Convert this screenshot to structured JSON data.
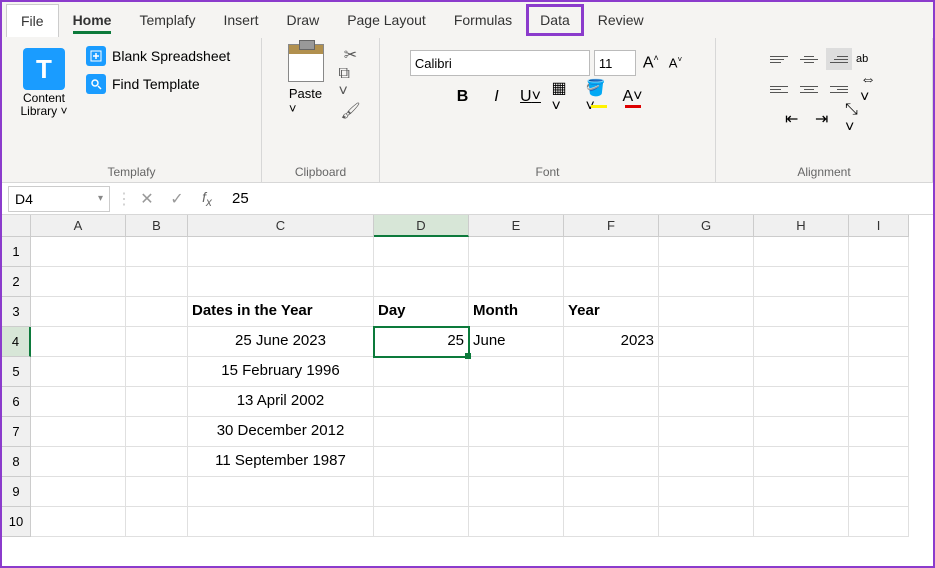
{
  "tabs": {
    "file": "File",
    "home": "Home",
    "templafy": "Templafy",
    "insert": "Insert",
    "draw": "Draw",
    "pagelayout": "Page Layout",
    "formulas": "Formulas",
    "data": "Data",
    "review": "Review"
  },
  "ribbon": {
    "templafy": {
      "label": "Templafy",
      "content_library": "Content Library",
      "blank": "Blank Spreadsheet",
      "find": "Find Template",
      "big_icon_letter": "T"
    },
    "clipboard": {
      "label": "Clipboard",
      "paste": "Paste"
    },
    "font": {
      "label": "Font",
      "name": "Calibri",
      "size": "11",
      "bold": "B",
      "italic": "I",
      "underline": "U",
      "letter_a": "A"
    },
    "alignment": {
      "label": "Alignment",
      "wrap": "ab"
    }
  },
  "formula_bar": {
    "name_box": "D4",
    "value": "25"
  },
  "grid": {
    "cols": [
      "A",
      "B",
      "C",
      "D",
      "E",
      "F",
      "G",
      "H",
      "I"
    ],
    "rows": [
      "1",
      "2",
      "3",
      "4",
      "5",
      "6",
      "7",
      "8",
      "9",
      "10"
    ],
    "headers": {
      "c": "Dates in the Year",
      "d": "Day",
      "e": "Month",
      "f": "Year"
    },
    "row4": {
      "c": "25 June 2023",
      "d": "25",
      "e": "June",
      "f": "2023"
    },
    "row5": {
      "c": "15 February 1996"
    },
    "row6": {
      "c": "13 April 2002"
    },
    "row7": {
      "c": "30 December 2012"
    },
    "row8": {
      "c": "11 September 1987"
    }
  }
}
